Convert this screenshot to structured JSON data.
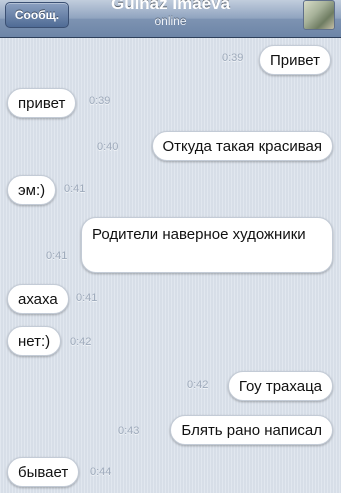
{
  "header": {
    "back_label": "Сообщ.",
    "contact_name": "Gulnaz Imaeva",
    "status": "online"
  },
  "messages": [
    {
      "text": "Привет",
      "time": "0:39",
      "from": "me"
    },
    {
      "text": "привет",
      "time": "0:39",
      "from": "contact"
    },
    {
      "text": "Откуда такая красивая",
      "time": "0:40",
      "from": "me"
    },
    {
      "text": "эм:)",
      "time": "0:41",
      "from": "contact"
    },
    {
      "text": "Родители наверное художники",
      "time": "0:41",
      "from": "me"
    },
    {
      "text": "ахаха",
      "time": "0:41",
      "from": "contact"
    },
    {
      "text": "нет:)",
      "time": "0:42",
      "from": "contact"
    },
    {
      "text": "Гоу трахаца",
      "time": "0:42",
      "from": "me"
    },
    {
      "text": "Блять рано написал",
      "time": "0:43",
      "from": "me"
    },
    {
      "text": "бывает",
      "time": "0:44",
      "from": "contact"
    }
  ],
  "colors": {
    "background": "#dbe2ec",
    "navbar": "#7d93b2",
    "bubble": "#ffffff",
    "timestamp": "#9eaabb"
  }
}
